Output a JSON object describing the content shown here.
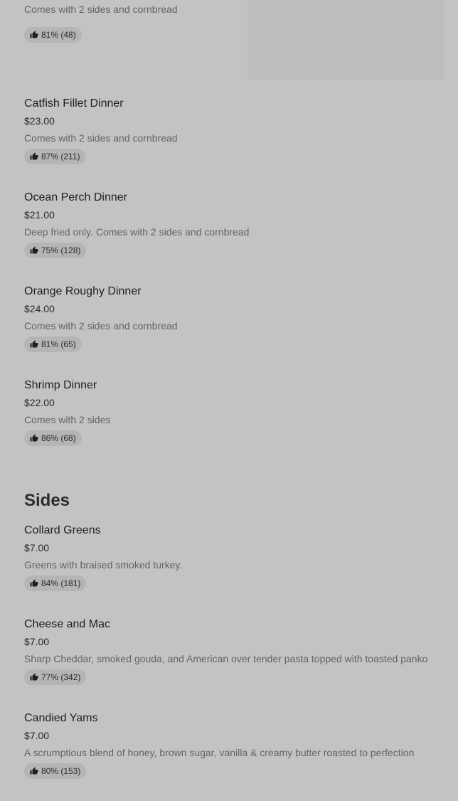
{
  "partial_item": {
    "description": "Comes with 2 sides and cornbread",
    "rating": "81% (48)"
  },
  "dinners": [
    {
      "name": "Catfish Fillet Dinner",
      "price": "$23.00",
      "description": "Comes with 2 sides and cornbread",
      "rating": "87% (211)"
    },
    {
      "name": "Ocean Perch Dinner",
      "price": "$21.00",
      "description": "Deep fried only. Comes with 2 sides and cornbread",
      "rating": "75% (128)"
    },
    {
      "name": "Orange Roughy Dinner",
      "price": "$24.00",
      "description": "Comes with 2 sides and cornbread",
      "rating": "81% (65)"
    },
    {
      "name": "Shrimp Dinner",
      "price": "$22.00",
      "description": "Comes with 2 sides",
      "rating": "86% (68)"
    }
  ],
  "sides_section": {
    "title": "Sides",
    "items": [
      {
        "name": "Collard Greens",
        "price": "$7.00",
        "description": "Greens with braised smoked turkey.",
        "rating": "84% (181)"
      },
      {
        "name": "Cheese and Mac",
        "price": "$7.00",
        "description": "Sharp Cheddar, smoked gouda, and American over tender pasta topped with toasted panko",
        "rating": "77% (342)"
      },
      {
        "name": "Candied Yams",
        "price": "$7.00",
        "description": "A scrumptious blend of honey, brown sugar, vanilla & creamy butter roasted to perfection",
        "rating": "80% (153)"
      }
    ]
  },
  "icons": {
    "rating_icon": "thumbs-up-icon"
  },
  "colors": {
    "background": "#c3c3c3",
    "rating_pill": "#b5b5b5",
    "image_placeholder": "#bdbdbd"
  }
}
